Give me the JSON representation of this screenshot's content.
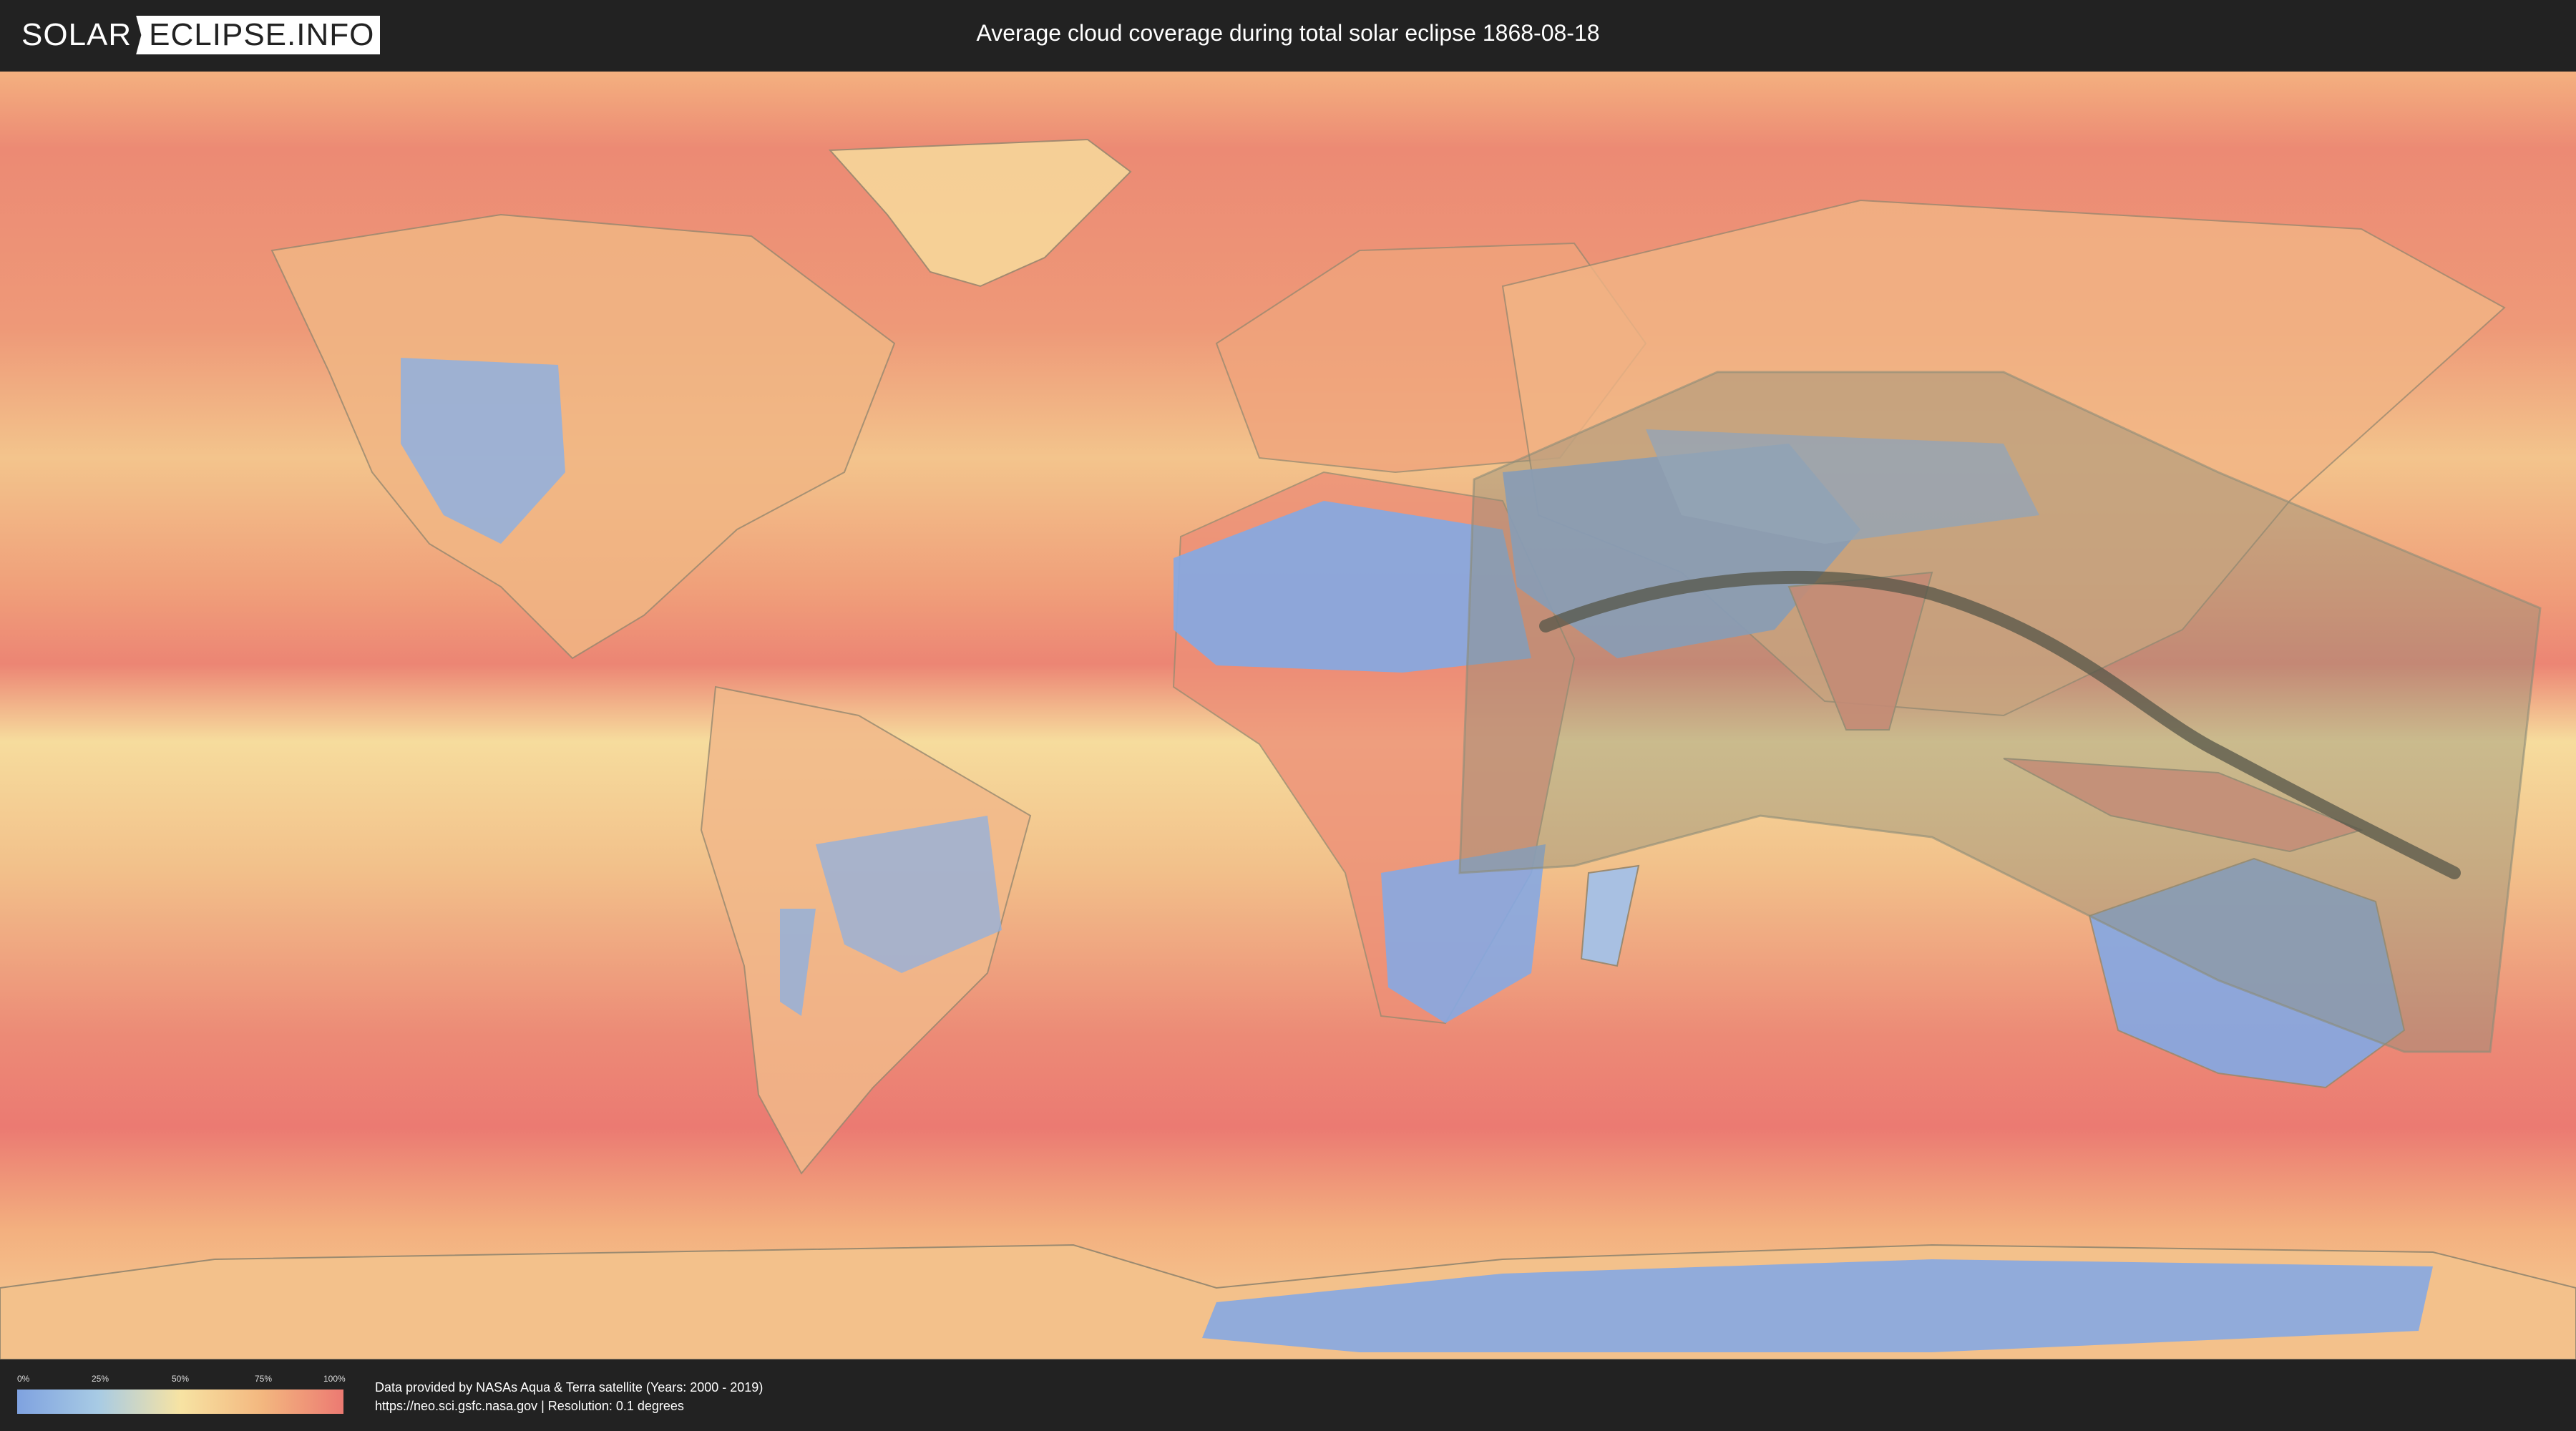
{
  "header": {
    "logo_part1": "SOLAR",
    "logo_part2": "ECLIPSE.INFO",
    "title": "Average cloud coverage during total solar eclipse 1868-08-18"
  },
  "map": {
    "layer": "average cloud coverage",
    "projection": "equirectangular world map",
    "eclipse_band_color": "#8c8c78",
    "central_line_color": "#555548"
  },
  "legend": {
    "ticks": [
      "0%",
      "25%",
      "50%",
      "75%",
      "100%"
    ],
    "colors": [
      "#7fa2e0",
      "#a8cbe4",
      "#f7e3a3",
      "#f3b77f",
      "#ec7a72"
    ]
  },
  "footer": {
    "source_line1": "Data provided by NASAs Aqua & Terra satellite (Years: 2000 - 2019)",
    "source_line2": "https://neo.sci.gsfc.nasa.gov | Resolution: 0.1 degrees"
  }
}
